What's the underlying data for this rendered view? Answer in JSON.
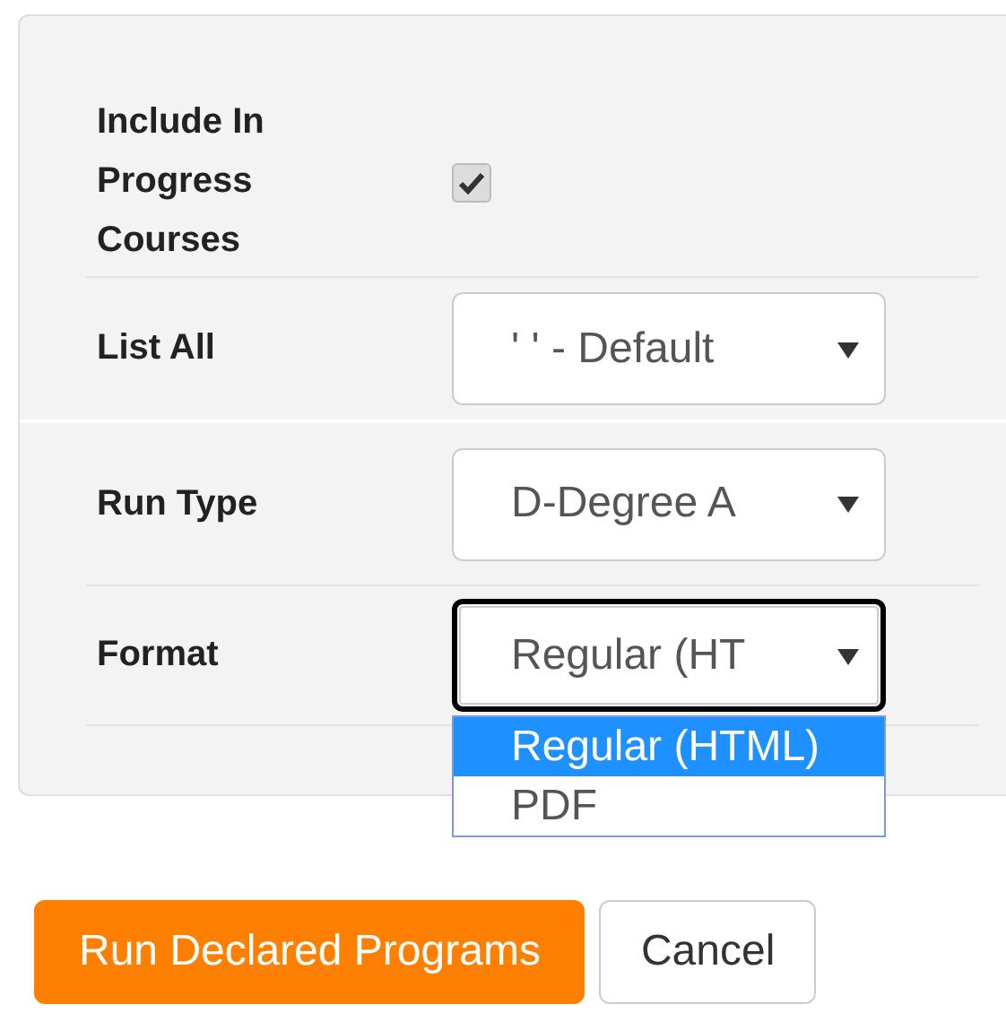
{
  "fields": [
    {
      "kind": "checkbox",
      "label": "Include In Progress Courses",
      "checked": true
    },
    {
      "kind": "select",
      "label": "List All",
      "value": "' ' - Default",
      "focused": false
    },
    {
      "kind": "select",
      "label": "Run Type",
      "value": "D-Degree A",
      "focused": false
    },
    {
      "kind": "select",
      "label": "Format",
      "value": "Regular (HT",
      "focused": true,
      "options": [
        {
          "label": "Regular (HTML)",
          "selected": true
        },
        {
          "label": "PDF",
          "selected": false
        }
      ]
    }
  ],
  "buttons": [
    {
      "label": "Run Declared Programs",
      "kind": "primary"
    },
    {
      "label": "Cancel",
      "kind": "default"
    }
  ]
}
